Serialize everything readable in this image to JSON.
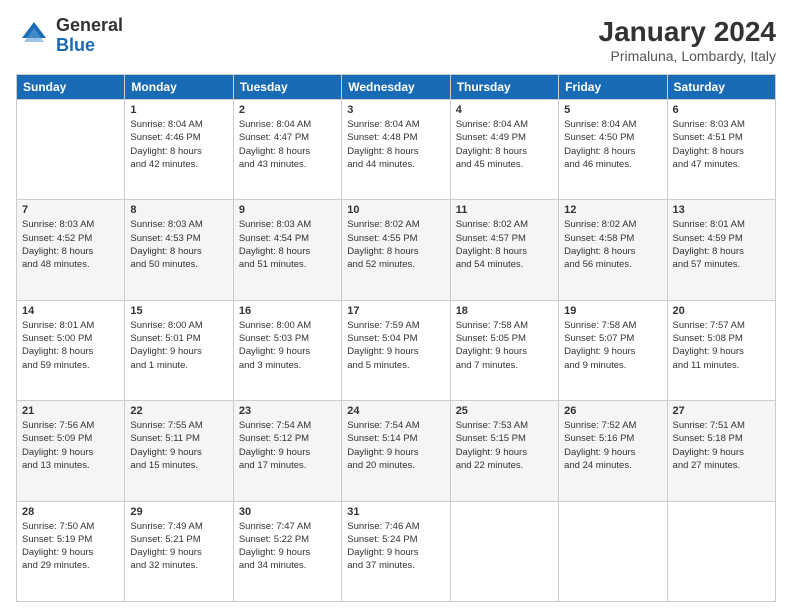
{
  "logo": {
    "general": "General",
    "blue": "Blue"
  },
  "title": "January 2024",
  "location": "Primaluna, Lombardy, Italy",
  "headers": [
    "Sunday",
    "Monday",
    "Tuesday",
    "Wednesday",
    "Thursday",
    "Friday",
    "Saturday"
  ],
  "weeks": [
    [
      {
        "day": "",
        "info": ""
      },
      {
        "day": "1",
        "info": "Sunrise: 8:04 AM\nSunset: 4:46 PM\nDaylight: 8 hours\nand 42 minutes."
      },
      {
        "day": "2",
        "info": "Sunrise: 8:04 AM\nSunset: 4:47 PM\nDaylight: 8 hours\nand 43 minutes."
      },
      {
        "day": "3",
        "info": "Sunrise: 8:04 AM\nSunset: 4:48 PM\nDaylight: 8 hours\nand 44 minutes."
      },
      {
        "day": "4",
        "info": "Sunrise: 8:04 AM\nSunset: 4:49 PM\nDaylight: 8 hours\nand 45 minutes."
      },
      {
        "day": "5",
        "info": "Sunrise: 8:04 AM\nSunset: 4:50 PM\nDaylight: 8 hours\nand 46 minutes."
      },
      {
        "day": "6",
        "info": "Sunrise: 8:03 AM\nSunset: 4:51 PM\nDaylight: 8 hours\nand 47 minutes."
      }
    ],
    [
      {
        "day": "7",
        "info": "Sunrise: 8:03 AM\nSunset: 4:52 PM\nDaylight: 8 hours\nand 48 minutes."
      },
      {
        "day": "8",
        "info": "Sunrise: 8:03 AM\nSunset: 4:53 PM\nDaylight: 8 hours\nand 50 minutes."
      },
      {
        "day": "9",
        "info": "Sunrise: 8:03 AM\nSunset: 4:54 PM\nDaylight: 8 hours\nand 51 minutes."
      },
      {
        "day": "10",
        "info": "Sunrise: 8:02 AM\nSunset: 4:55 PM\nDaylight: 8 hours\nand 52 minutes."
      },
      {
        "day": "11",
        "info": "Sunrise: 8:02 AM\nSunset: 4:57 PM\nDaylight: 8 hours\nand 54 minutes."
      },
      {
        "day": "12",
        "info": "Sunrise: 8:02 AM\nSunset: 4:58 PM\nDaylight: 8 hours\nand 56 minutes."
      },
      {
        "day": "13",
        "info": "Sunrise: 8:01 AM\nSunset: 4:59 PM\nDaylight: 8 hours\nand 57 minutes."
      }
    ],
    [
      {
        "day": "14",
        "info": "Sunrise: 8:01 AM\nSunset: 5:00 PM\nDaylight: 8 hours\nand 59 minutes."
      },
      {
        "day": "15",
        "info": "Sunrise: 8:00 AM\nSunset: 5:01 PM\nDaylight: 9 hours\nand 1 minute."
      },
      {
        "day": "16",
        "info": "Sunrise: 8:00 AM\nSunset: 5:03 PM\nDaylight: 9 hours\nand 3 minutes."
      },
      {
        "day": "17",
        "info": "Sunrise: 7:59 AM\nSunset: 5:04 PM\nDaylight: 9 hours\nand 5 minutes."
      },
      {
        "day": "18",
        "info": "Sunrise: 7:58 AM\nSunset: 5:05 PM\nDaylight: 9 hours\nand 7 minutes."
      },
      {
        "day": "19",
        "info": "Sunrise: 7:58 AM\nSunset: 5:07 PM\nDaylight: 9 hours\nand 9 minutes."
      },
      {
        "day": "20",
        "info": "Sunrise: 7:57 AM\nSunset: 5:08 PM\nDaylight: 9 hours\nand 11 minutes."
      }
    ],
    [
      {
        "day": "21",
        "info": "Sunrise: 7:56 AM\nSunset: 5:09 PM\nDaylight: 9 hours\nand 13 minutes."
      },
      {
        "day": "22",
        "info": "Sunrise: 7:55 AM\nSunset: 5:11 PM\nDaylight: 9 hours\nand 15 minutes."
      },
      {
        "day": "23",
        "info": "Sunrise: 7:54 AM\nSunset: 5:12 PM\nDaylight: 9 hours\nand 17 minutes."
      },
      {
        "day": "24",
        "info": "Sunrise: 7:54 AM\nSunset: 5:14 PM\nDaylight: 9 hours\nand 20 minutes."
      },
      {
        "day": "25",
        "info": "Sunrise: 7:53 AM\nSunset: 5:15 PM\nDaylight: 9 hours\nand 22 minutes."
      },
      {
        "day": "26",
        "info": "Sunrise: 7:52 AM\nSunset: 5:16 PM\nDaylight: 9 hours\nand 24 minutes."
      },
      {
        "day": "27",
        "info": "Sunrise: 7:51 AM\nSunset: 5:18 PM\nDaylight: 9 hours\nand 27 minutes."
      }
    ],
    [
      {
        "day": "28",
        "info": "Sunrise: 7:50 AM\nSunset: 5:19 PM\nDaylight: 9 hours\nand 29 minutes."
      },
      {
        "day": "29",
        "info": "Sunrise: 7:49 AM\nSunset: 5:21 PM\nDaylight: 9 hours\nand 32 minutes."
      },
      {
        "day": "30",
        "info": "Sunrise: 7:47 AM\nSunset: 5:22 PM\nDaylight: 9 hours\nand 34 minutes."
      },
      {
        "day": "31",
        "info": "Sunrise: 7:46 AM\nSunset: 5:24 PM\nDaylight: 9 hours\nand 37 minutes."
      },
      {
        "day": "",
        "info": ""
      },
      {
        "day": "",
        "info": ""
      },
      {
        "day": "",
        "info": ""
      }
    ]
  ]
}
